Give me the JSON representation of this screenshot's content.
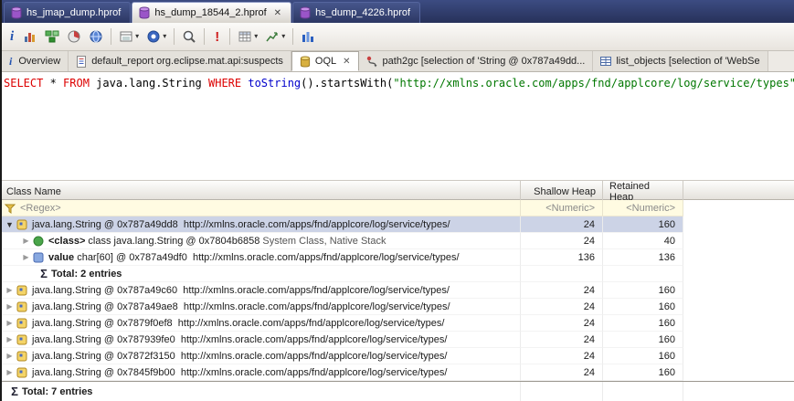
{
  "icons": {
    "close": "✕",
    "dropdown": "▾",
    "expanded": "▼",
    "collapsed": "▶",
    "sigma": "Σ",
    "info": "i",
    "error": "!"
  },
  "colors": {
    "keyword": "#dd0000",
    "string_literal": "#007700",
    "method": "#0000cc",
    "selection": "#ccd3e6",
    "filter_row_bg": "#fffbe2",
    "tab_bar_bg": "#2c3a67"
  },
  "editor_tabs": [
    {
      "label": "hs_jmap_dump.hprof"
    },
    {
      "label": "hs_dump_18544_2.hprof"
    },
    {
      "label": "hs_dump_4226.hprof"
    }
  ],
  "view_tabs": [
    {
      "label": "Overview"
    },
    {
      "label": "default_report org.eclipse.mat.api:suspects"
    },
    {
      "label": "OQL"
    },
    {
      "label": "path2gc [selection of 'String @ 0x787a49dd..."
    },
    {
      "label": "list_objects [selection of 'WebSe"
    }
  ],
  "query": {
    "select": "SELECT",
    "star": " * ",
    "from": "FROM",
    "cls": " java.lang.String ",
    "where": "WHERE",
    "sp": " ",
    "tostring": "toString",
    "mid": "().",
    "startswith": "startsWith",
    "open": "(",
    "literal": "\"http://xmlns.oracle.com/apps/fnd/applcore/log/service/types\"",
    "close": ")"
  },
  "table": {
    "columns": {
      "name": "Class Name",
      "shallow": "Shallow Heap",
      "retained": "Retained Heap"
    },
    "filter": {
      "name": "<Regex>",
      "shallow": "<Numeric>",
      "retained": "<Numeric>"
    },
    "rows": [
      {
        "text": "java.lang.String @ 0x787a49dd8  http://xmlns.oracle.com/apps/fnd/applcore/log/service/types/",
        "shallow": "24",
        "retained": "160"
      },
      {
        "bold": "<class>",
        "text": " class java.lang.String @ 0x7804b6858 ",
        "suffix": "System Class, Native Stack",
        "shallow": "24",
        "retained": "40"
      },
      {
        "bold": "value",
        "text": " char[60] @ 0x787a49df0  http://xmlns.oracle.com/apps/fnd/applcore/log/service/types/",
        "shallow": "136",
        "retained": "136"
      },
      {
        "total": "Total: 2 entries"
      },
      {
        "text": "java.lang.String @ 0x787a49c60  http://xmlns.oracle.com/apps/fnd/applcore/log/service/types/",
        "shallow": "24",
        "retained": "160"
      },
      {
        "text": "java.lang.String @ 0x787a49ae8  http://xmlns.oracle.com/apps/fnd/applcore/log/service/types/",
        "shallow": "24",
        "retained": "160"
      },
      {
        "text": "java.lang.String @ 0x7879f0ef8  http://xmlns.oracle.com/apps/fnd/applcore/log/service/types/",
        "shallow": "24",
        "retained": "160"
      },
      {
        "text": "java.lang.String @ 0x787939fe0  http://xmlns.oracle.com/apps/fnd/applcore/log/service/types/",
        "shallow": "24",
        "retained": "160"
      },
      {
        "text": "java.lang.String @ 0x7872f3150  http://xmlns.oracle.com/apps/fnd/applcore/log/service/types/",
        "shallow": "24",
        "retained": "160"
      },
      {
        "text": "java.lang.String @ 0x7845f9b00  http://xmlns.oracle.com/apps/fnd/applcore/log/service/types/",
        "shallow": "24",
        "retained": "160"
      }
    ],
    "footer": "Total: 7 entries"
  }
}
